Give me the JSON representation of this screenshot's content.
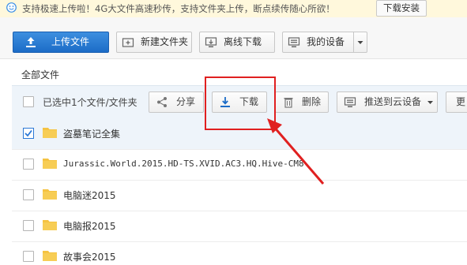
{
  "banner": {
    "text": "支持极速上传啦！4G大文件高速秒传，支持文件夹上传，断点续传随心所欲！",
    "button": "下载安装"
  },
  "toolbar": {
    "upload": "上传文件",
    "new_folder": "新建文件夹",
    "offline_download": "离线下载",
    "my_device": "我的设备"
  },
  "breadcrumb": "全部文件",
  "selection": {
    "text": "已选中1个文件/文件夹",
    "share": "分享",
    "download": "下载",
    "delete": "删除",
    "push": "推送到云设备",
    "more": "更"
  },
  "files": [
    {
      "name": "盗墓笔记全集",
      "checked": true
    },
    {
      "name": "Jurassic.World.2015.HD-TS.XVID.AC3.HQ.Hive-CM8",
      "checked": false
    },
    {
      "name": "电脑迷2015",
      "checked": false
    },
    {
      "name": "电脑报2015",
      "checked": false
    },
    {
      "name": "故事会2015",
      "checked": false
    }
  ],
  "colors": {
    "accent": "#1c6cc7",
    "highlight": "#e02020",
    "folder": "#f5c342",
    "selected_row": "#eef4fa"
  }
}
